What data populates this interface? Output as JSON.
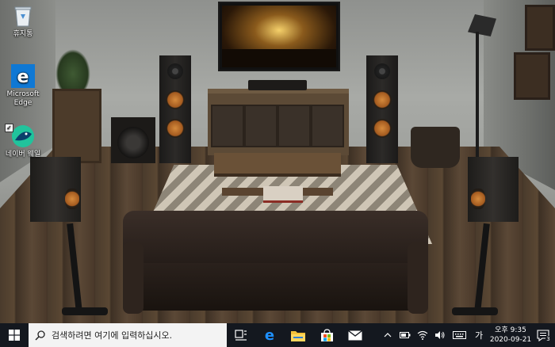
{
  "desktop": {
    "icons": [
      {
        "label": "휴지통"
      },
      {
        "label": "Microsoft Edge"
      },
      {
        "label": "네이버 웨일"
      }
    ]
  },
  "taskbar": {
    "search_placeholder": "검색하려면 여기에 입력하십시오.",
    "apps": [
      "task-view",
      "edge",
      "file-explorer",
      "microsoft-store",
      "mail"
    ],
    "tray": {
      "ime": "가",
      "time": "오후 9:35",
      "date": "2020-09-21",
      "notification_count": "3"
    }
  },
  "colors": {
    "taskbar": "#14181f",
    "edge_blue": "#0f78d4",
    "whale_green": "#21c39c"
  }
}
